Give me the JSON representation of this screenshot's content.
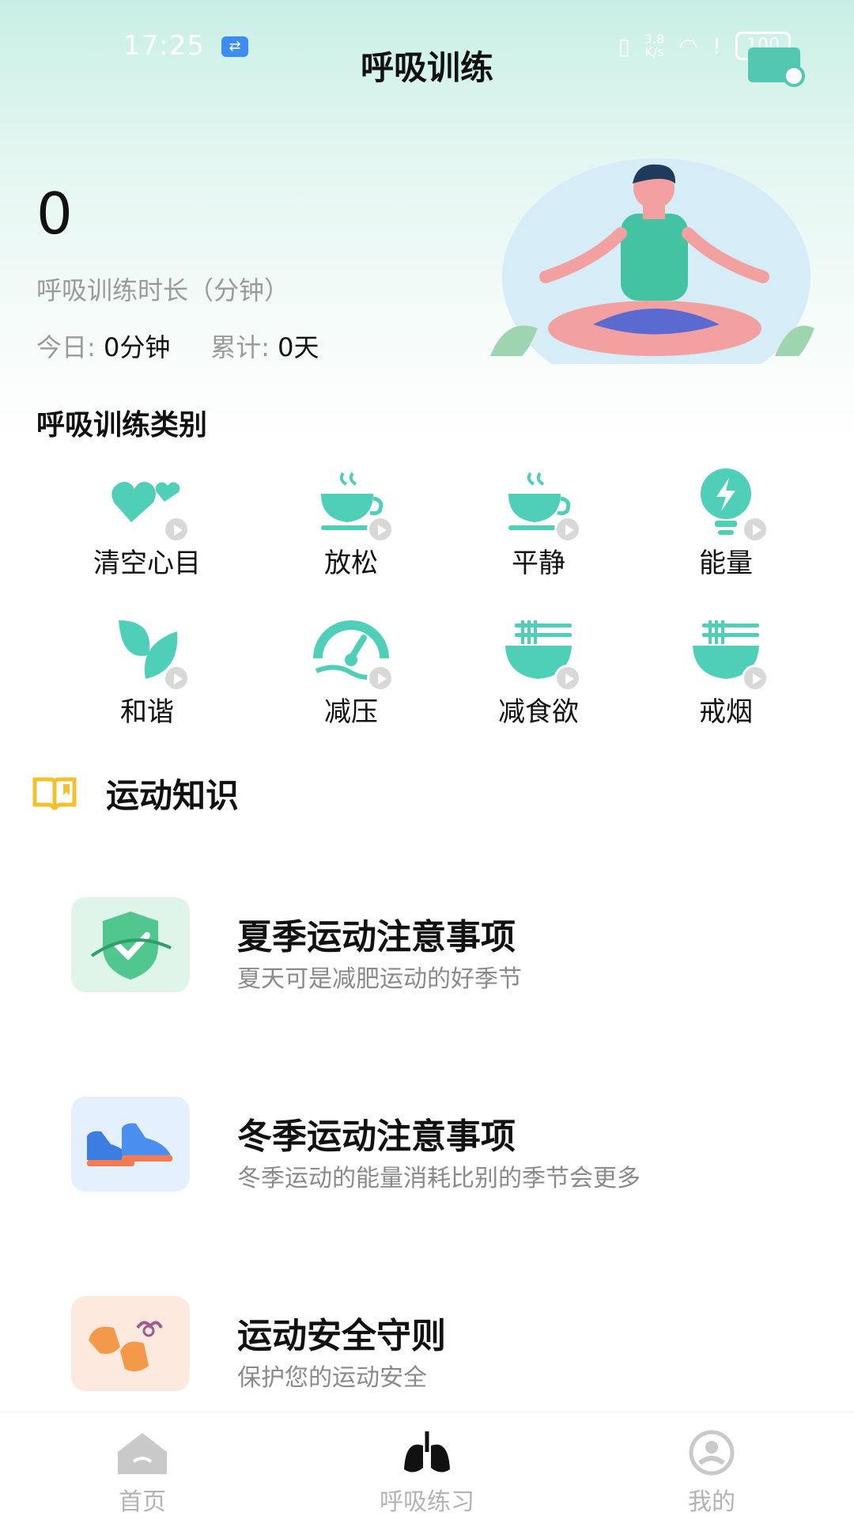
{
  "status_bar": {
    "time": "17:25",
    "net_speed_top": "3.8",
    "net_speed_bottom": "K/s",
    "battery": "100"
  },
  "header": {
    "title": "呼吸训练"
  },
  "stats": {
    "total_value": "0",
    "total_label": "呼吸训练时长（分钟）",
    "today_label": "今日:",
    "today_value": "0分钟",
    "total_days_label": "累计:",
    "total_days_value": "0天"
  },
  "categories": {
    "title": "呼吸训练类别",
    "items": [
      {
        "label": "清空心目",
        "icon": "hearts-icon"
      },
      {
        "label": "放松",
        "icon": "cup-icon"
      },
      {
        "label": "平静",
        "icon": "cup-icon"
      },
      {
        "label": "能量",
        "icon": "bulb-icon"
      },
      {
        "label": "和谐",
        "icon": "leaves-icon"
      },
      {
        "label": "减压",
        "icon": "gauge-icon"
      },
      {
        "label": "减食欲",
        "icon": "noodle-bowl-icon"
      },
      {
        "label": "戒烟",
        "icon": "noodle-bowl-icon"
      }
    ]
  },
  "knowledge": {
    "title": "运动知识",
    "items": [
      {
        "title": "夏季运动注意事项",
        "subtitle": "夏天可是减肥运动的好季节",
        "icon": "shield-check-icon"
      },
      {
        "title": "冬季运动注意事项",
        "subtitle": "冬季运动的能量消耗比别的季节会更多",
        "icon": "sneakers-icon"
      },
      {
        "title": "运动安全守则",
        "subtitle": "保护您的运动安全",
        "icon": "gloves-icon"
      }
    ]
  },
  "tabbar": {
    "tabs": [
      {
        "label": "首页",
        "icon": "home-icon"
      },
      {
        "label": "呼吸练习",
        "icon": "lungs-icon"
      },
      {
        "label": "我的",
        "icon": "profile-icon"
      }
    ]
  },
  "colors": {
    "accent": "#5fd0bb",
    "bg_top": "#c8efe5",
    "muted": "#9a9a9a"
  }
}
